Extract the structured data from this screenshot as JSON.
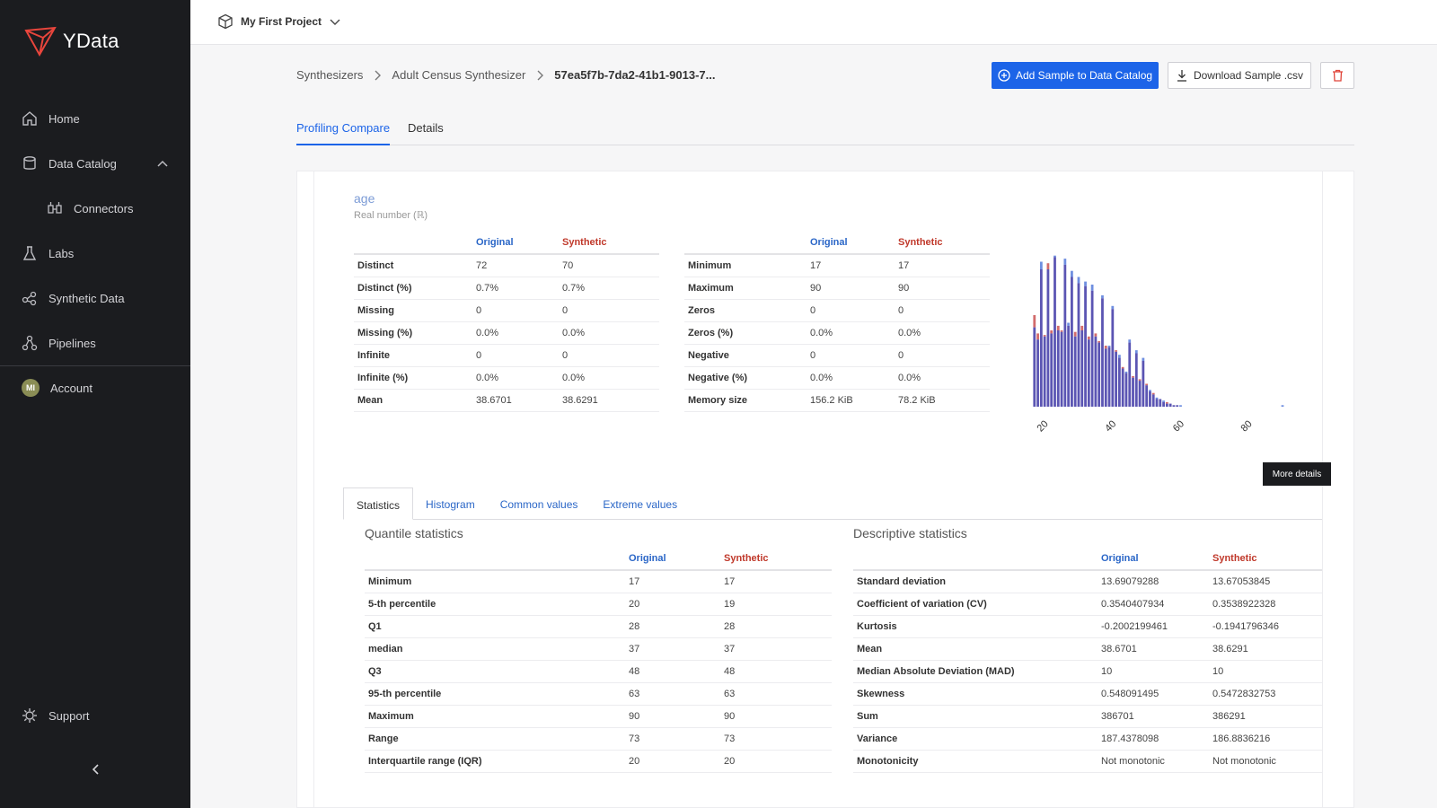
{
  "app": {
    "name": "YData"
  },
  "sidebar": {
    "items": [
      {
        "label": "Home",
        "icon": "home-icon"
      },
      {
        "label": "Data Catalog",
        "icon": "database-icon"
      },
      {
        "label": "Connectors",
        "icon": "connectors-icon"
      },
      {
        "label": "Labs",
        "icon": "flask-icon"
      },
      {
        "label": "Synthetic Data",
        "icon": "synthetic-data-icon"
      },
      {
        "label": "Pipelines",
        "icon": "pipelines-icon"
      }
    ],
    "account": {
      "label": "Account",
      "initials": "MI"
    },
    "support": {
      "label": "Support"
    }
  },
  "topbar": {
    "project": "My First Project"
  },
  "breadcrumb": [
    "Synthesizers",
    "Adult Census Synthesizer",
    "57ea5f7b-7da2-41b1-9013-7..."
  ],
  "actions": {
    "add_sample": "Add Sample to Data Catalog",
    "download": "Download Sample .csv"
  },
  "tabs": [
    "Profiling Compare",
    "Details"
  ],
  "variable": {
    "name": "age",
    "type": "Real number (ℝ)"
  },
  "overview": {
    "headers": {
      "original": "Original",
      "synthetic": "Synthetic"
    },
    "left": [
      [
        "Distinct",
        "72",
        "70"
      ],
      [
        "Distinct (%)",
        "0.7%",
        "0.7%"
      ],
      [
        "Missing",
        "0",
        "0"
      ],
      [
        "Missing (%)",
        "0.0%",
        "0.0%"
      ],
      [
        "Infinite",
        "0",
        "0"
      ],
      [
        "Infinite (%)",
        "0.0%",
        "0.0%"
      ],
      [
        "Mean",
        "38.6701",
        "38.6291"
      ]
    ],
    "right": [
      [
        "Minimum",
        "17",
        "17"
      ],
      [
        "Maximum",
        "90",
        "90"
      ],
      [
        "Zeros",
        "0",
        "0"
      ],
      [
        "Zeros (%)",
        "0.0%",
        "0.0%"
      ],
      [
        "Negative",
        "0",
        "0"
      ],
      [
        "Negative (%)",
        "0.0%",
        "0.0%"
      ],
      [
        "Memory size",
        "156.2 KiB",
        "78.2 KiB"
      ]
    ]
  },
  "histogram": {
    "x_ticks": [
      "20",
      "40",
      "60",
      "80"
    ],
    "xlim": [
      17,
      91
    ],
    "ylim": [
      0,
      1
    ],
    "original_color": "#6f8fe0",
    "synthetic_color": "#d26b6b",
    "overlap_color": "#5b55b3",
    "x": [
      17,
      18,
      19,
      20,
      21,
      22,
      23,
      24,
      25,
      26,
      27,
      28,
      29,
      30,
      31,
      32,
      33,
      34,
      35,
      36,
      37,
      38,
      39,
      40,
      41,
      42,
      43,
      44,
      45,
      46,
      47,
      48,
      49,
      50,
      51,
      52,
      53,
      54,
      55,
      56,
      57,
      58,
      59,
      60,
      61,
      62,
      63,
      64,
      65,
      66,
      67,
      68,
      69,
      70,
      71,
      72,
      73,
      74,
      75,
      76,
      77,
      78,
      79,
      80,
      81,
      82,
      83,
      84,
      85,
      86,
      87,
      88,
      89,
      90
    ],
    "original": [
      0.52,
      0.44,
      0.95,
      0.46,
      0.9,
      0.48,
      0.99,
      0.5,
      0.49,
      0.97,
      0.55,
      0.89,
      0.46,
      0.85,
      0.5,
      0.82,
      0.44,
      0.8,
      0.46,
      0.42,
      0.73,
      0.38,
      0.4,
      0.66,
      0.36,
      0.34,
      0.25,
      0.23,
      0.44,
      0.19,
      0.37,
      0.17,
      0.32,
      0.14,
      0.11,
      0.08,
      0.06,
      0.05,
      0.04,
      0.02,
      0.02,
      0.01,
      0.01,
      0.01,
      0,
      0,
      0,
      0,
      0,
      0,
      0,
      0,
      0,
      0,
      0,
      0,
      0,
      0,
      0,
      0,
      0,
      0,
      0,
      0,
      0,
      0,
      0,
      0,
      0,
      0,
      0,
      0,
      0,
      0.01
    ],
    "synthetic": [
      0.6,
      0.48,
      0.9,
      0.47,
      0.94,
      0.5,
      0.98,
      0.53,
      0.5,
      0.93,
      0.53,
      0.85,
      0.49,
      0.81,
      0.53,
      0.79,
      0.46,
      0.76,
      0.48,
      0.43,
      0.71,
      0.4,
      0.39,
      0.64,
      0.37,
      0.32,
      0.26,
      0.22,
      0.42,
      0.2,
      0.35,
      0.18,
      0.3,
      0.15,
      0.1,
      0.09,
      0.05,
      0.05,
      0.03,
      0.03,
      0.02,
      0.01,
      0.01,
      0,
      0,
      0,
      0,
      0,
      0,
      0,
      0,
      0,
      0,
      0,
      0,
      0,
      0,
      0,
      0,
      0,
      0,
      0,
      0,
      0,
      0,
      0,
      0,
      0,
      0,
      0,
      0,
      0,
      0,
      0
    ]
  },
  "more_details": "More details",
  "subtabs": [
    "Statistics",
    "Histogram",
    "Common values",
    "Extreme values"
  ],
  "quantile": {
    "title": "Quantile statistics",
    "rows": [
      [
        "Minimum",
        "17",
        "17"
      ],
      [
        "5-th percentile",
        "20",
        "19"
      ],
      [
        "Q1",
        "28",
        "28"
      ],
      [
        "median",
        "37",
        "37"
      ],
      [
        "Q3",
        "48",
        "48"
      ],
      [
        "95-th percentile",
        "63",
        "63"
      ],
      [
        "Maximum",
        "90",
        "90"
      ],
      [
        "Range",
        "73",
        "73"
      ],
      [
        "Interquartile range (IQR)",
        "20",
        "20"
      ]
    ]
  },
  "descriptive": {
    "title": "Descriptive statistics",
    "rows": [
      [
        "Standard deviation",
        "13.69079288",
        "13.67053845"
      ],
      [
        "Coefficient of variation (CV)",
        "0.3540407934",
        "0.3538922328"
      ],
      [
        "Kurtosis",
        "-0.2002199461",
        "-0.1941796346"
      ],
      [
        "Mean",
        "38.6701",
        "38.6291"
      ],
      [
        "Median Absolute Deviation (MAD)",
        "10",
        "10"
      ],
      [
        "Skewness",
        "0.548091495",
        "0.5472832753"
      ],
      [
        "Sum",
        "386701",
        "386291"
      ],
      [
        "Variance",
        "187.4378098",
        "186.8836216"
      ],
      [
        "Monotonicity",
        "Not monotonic",
        "Not monotonic"
      ]
    ]
  }
}
